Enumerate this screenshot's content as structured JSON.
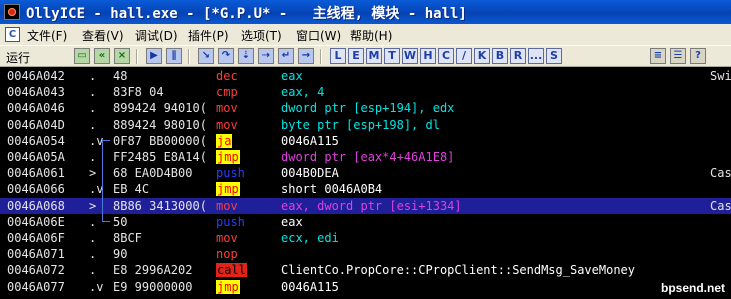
{
  "window": {
    "title": "OllyICE - hall.exe - [*G.P.U* -   主线程, 模块 - hall]"
  },
  "menubar": {
    "items": [
      "文件(F)",
      "查看(V)",
      "调试(D)",
      "插件(P)",
      "选项(T)",
      "窗口(W)",
      "帮助(H)"
    ]
  },
  "toolbar": {
    "status": "运行",
    "letters": [
      "L",
      "E",
      "M",
      "T",
      "W",
      "H",
      "C",
      "/",
      "K",
      "B",
      "R",
      "...",
      "S"
    ]
  },
  "colors": {
    "mn_default": "#ff3c3c",
    "mn_blue": "#2b3cff",
    "operand_cyan": "#00e5e5",
    "operand_magenta": "#e040e0",
    "operand_white": "#ffffff",
    "selected_row": "#1f1f9a"
  },
  "disasm": {
    "rows": [
      {
        "addr": "0046A042",
        "mark": ".",
        "hex": "48",
        "mnemonic": "dec",
        "operand": "eax",
        "comment": "Swi"
      },
      {
        "addr": "0046A043",
        "mark": ".",
        "hex": "83F8 04",
        "mnemonic": "cmp",
        "operand": "eax, 4",
        "comment": ""
      },
      {
        "addr": "0046A046",
        "mark": ".",
        "hex": "899424 94010(",
        "mnemonic": "mov",
        "operand": "dword ptr [esp+194], edx",
        "comment": ""
      },
      {
        "addr": "0046A04D",
        "mark": ".",
        "hex": "889424 98010(",
        "mnemonic": "mov",
        "operand": "byte ptr [esp+198], dl",
        "comment": ""
      },
      {
        "addr": "0046A054",
        "mark": ".v",
        "hex": "0F87 BB00000(",
        "mnemonic": "ja",
        "operand": "0046A115",
        "comment": ""
      },
      {
        "addr": "0046A05A",
        "mark": ".",
        "hex": "FF2485 E8A14(",
        "mnemonic": "jmp",
        "operand": "dword ptr [eax*4+46A1E8]",
        "comment": ""
      },
      {
        "addr": "0046A061",
        "mark": ">",
        "hex": "68 EA0D4B00",
        "mnemonic": "push",
        "operand": "004B0DEA",
        "comment": "Cas"
      },
      {
        "addr": "0046A066",
        "mark": ".v",
        "hex": "EB 4C",
        "mnemonic": "jmp",
        "operand": "short 0046A0B4",
        "comment": ""
      },
      {
        "addr": "0046A068",
        "mark": ">",
        "hex": "8B86 3413000(",
        "mnemonic": "mov",
        "operand": "eax, dword ptr [esi+1334]",
        "comment": "Cas"
      },
      {
        "addr": "0046A06E",
        "mark": ".",
        "hex": "50",
        "mnemonic": "push",
        "operand": "eax",
        "comment": ""
      },
      {
        "addr": "0046A06F",
        "mark": ".",
        "hex": "8BCF",
        "mnemonic": "mov",
        "operand": "ecx, edi",
        "comment": ""
      },
      {
        "addr": "0046A071",
        "mark": ".",
        "hex": "90",
        "mnemonic": "nop",
        "operand": "",
        "comment": ""
      },
      {
        "addr": "0046A072",
        "mark": ".",
        "hex": "E8 2996A202",
        "mnemonic": "call",
        "operand": "ClientCo.PropCore::CPropClient::SendMsg_SaveMoney",
        "comment": ""
      },
      {
        "addr": "0046A077",
        "mark": ".v",
        "hex": "E9 99000000",
        "mnemonic": "jmp",
        "operand": "0046A115",
        "comment": ""
      }
    ]
  },
  "watermark": "bpsend.net"
}
